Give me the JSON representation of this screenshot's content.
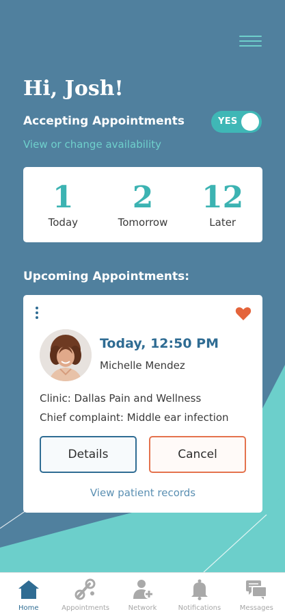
{
  "header": {
    "greeting": "Hi, Josh!",
    "menu_icon": "hamburger-menu-icon"
  },
  "availability": {
    "label": "Accepting Appointments",
    "toggle_text": "YES",
    "toggle_on": true,
    "link": "View or change availability"
  },
  "stats": [
    {
      "value": "1",
      "label": "Today"
    },
    {
      "value": "2",
      "label": "Tomorrow"
    },
    {
      "value": "12",
      "label": "Later"
    }
  ],
  "upcoming": {
    "title": "Upcoming Appointments:",
    "appointment": {
      "time": "Today, 12:50 PM",
      "patient": "Michelle Mendez",
      "clinic": "Clinic: Dallas Pain and Wellness",
      "complaint": "Chief complaint: Middle ear infection",
      "details_label": "Details",
      "cancel_label": "Cancel",
      "records_link": "View patient records",
      "favorited": true
    }
  },
  "nav": [
    {
      "label": "Home",
      "icon": "home-icon",
      "active": true
    },
    {
      "label": "Appointments",
      "icon": "appointments-icon",
      "active": false
    },
    {
      "label": "Network",
      "icon": "network-icon",
      "active": false
    },
    {
      "label": "Notifications",
      "icon": "bell-icon",
      "active": false
    },
    {
      "label": "Messages",
      "icon": "messages-icon",
      "active": false
    }
  ],
  "colors": {
    "background": "#50809e",
    "accent_teal": "#3cb3b2",
    "primary_blue": "#2f6c93",
    "cancel_orange": "#e4724d",
    "heart": "#e4643b"
  }
}
